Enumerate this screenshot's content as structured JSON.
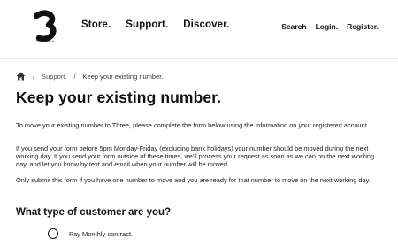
{
  "header": {
    "logo_caption": "Three.co.uk",
    "main_nav": [
      "Store.",
      "Support.",
      "Discover."
    ],
    "utility_nav": [
      "Search",
      "Login.",
      "Register."
    ]
  },
  "breadcrumb": {
    "items": [
      "Support.",
      "Keep your existing number."
    ]
  },
  "page": {
    "title": "Keep your existing number.",
    "paragraphs": [
      "To move your existing number to Three, please complete the form below using the information on your registered account.",
      "If you send your form before 5pm Monday-Friday (excluding bank holidays) your number should be moved during the next working day. If you send your form outside of these times, we'll process your request as soon as we can on the next working day, and let you know by text and email when your number will be moved.",
      "Only submit this form if you have one number to move and you are ready for that number to move on the next working day."
    ],
    "section_heading": "What type of customer are you?",
    "options": [
      "Pay Monthly contract."
    ]
  },
  "icons": {
    "home": "home-icon",
    "logo": "three-logo-icon",
    "radio": "radio-icon"
  }
}
